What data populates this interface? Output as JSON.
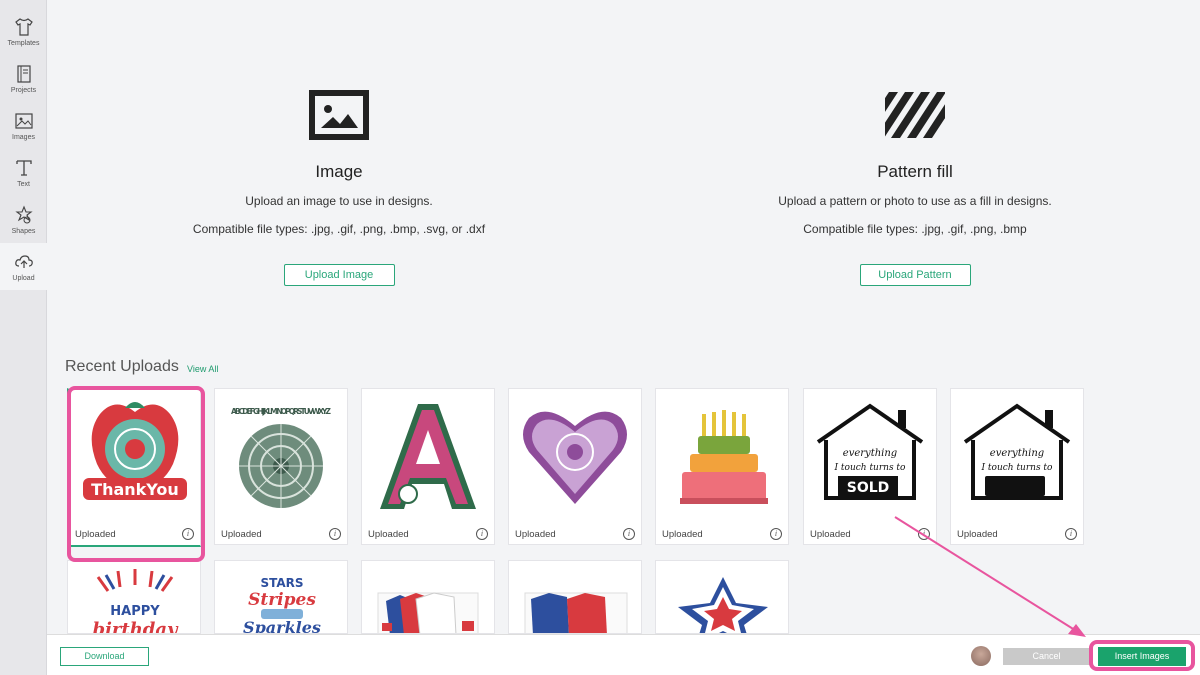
{
  "sidebar": {
    "items": [
      {
        "label": "Templates",
        "icon": "tshirt-icon"
      },
      {
        "label": "Projects",
        "icon": "notebook-icon"
      },
      {
        "label": "Images",
        "icon": "image-icon"
      },
      {
        "label": "Text",
        "icon": "text-t-icon"
      },
      {
        "label": "Shapes",
        "icon": "shapes-icon"
      },
      {
        "label": "Upload",
        "icon": "cloud-upload-icon"
      }
    ],
    "active": "Upload"
  },
  "upload_image": {
    "title": "Image",
    "desc": "Upload an image to use in designs.",
    "types": "Compatible file types: .jpg, .gif, .png, .bmp, .svg, or .dxf",
    "button": "Upload Image"
  },
  "upload_pattern": {
    "title": "Pattern fill",
    "desc": "Upload a pattern or photo to use as a fill in designs.",
    "types": "Compatible file types: .jpg, .gif, .png, .bmp",
    "button": "Upload Pattern"
  },
  "recent": {
    "title": "Recent Uploads",
    "view_all": "View All",
    "tiles": [
      {
        "caption": "Uploaded",
        "art_text": "ThankYou"
      },
      {
        "caption": "Uploaded",
        "art_text": "ABCDEFGHIJKLM NOPQRSTUVWXYZ"
      },
      {
        "caption": "Uploaded",
        "art_text": "A"
      },
      {
        "caption": "Uploaded"
      },
      {
        "caption": "Uploaded"
      },
      {
        "caption": "Uploaded",
        "art_text": "everything I touch turns to SOLD"
      },
      {
        "caption": "Uploaded",
        "art_text": "everything I touch turns to"
      }
    ],
    "row2": [
      {
        "art_text": "HAPPY birthday"
      },
      {
        "art_text": "STARS Stripes and Sparkles"
      },
      {},
      {},
      {}
    ]
  },
  "footer": {
    "download": "Download",
    "cancel": "Cancel",
    "insert": "Insert Images"
  },
  "colors": {
    "accent": "#2aa67a",
    "insert_bg": "#1aa36c",
    "highlight": "#e8559e"
  }
}
